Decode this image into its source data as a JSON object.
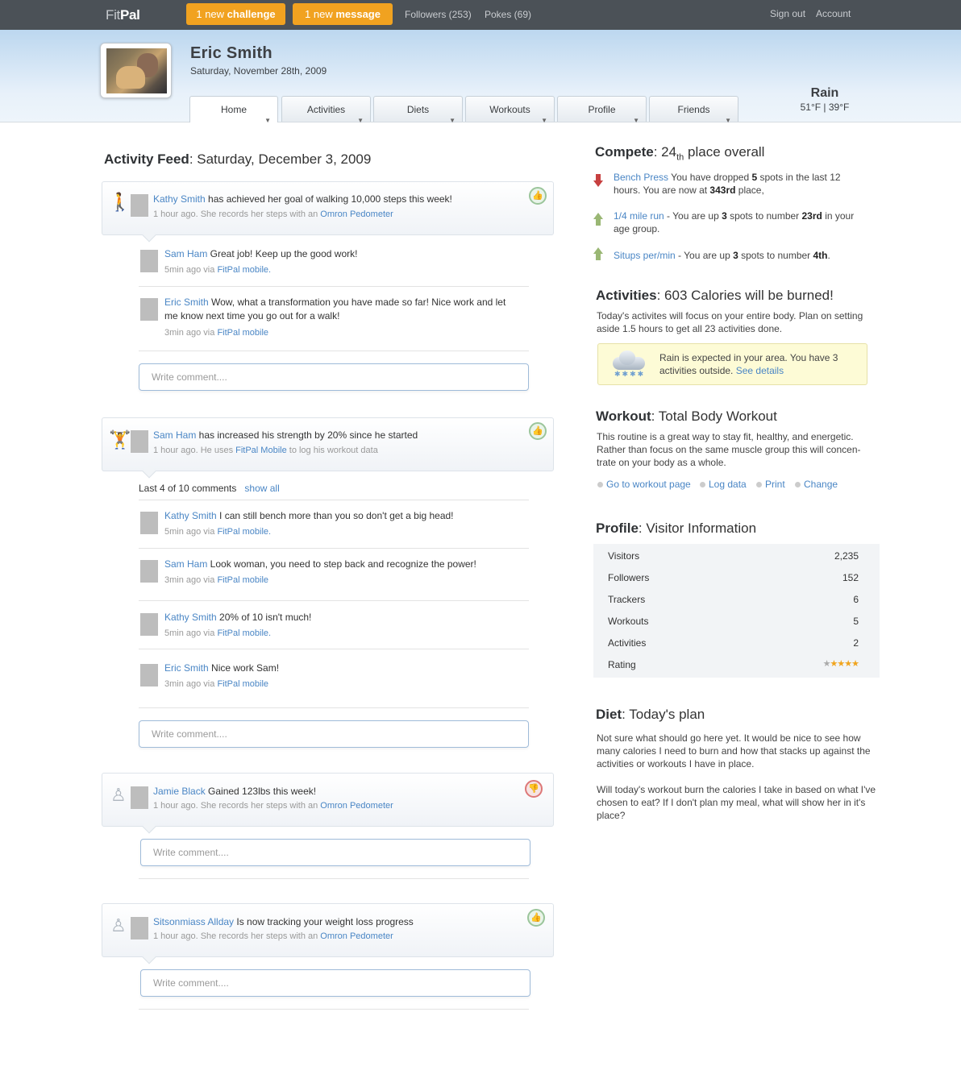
{
  "app": {
    "logo_light": "Fit",
    "logo_bold": "Pal"
  },
  "topbar": {
    "challenge_count": "1 new ",
    "challenge_word": "challenge",
    "message_count": "1 new ",
    "message_word": "message",
    "followers": "Followers (253)",
    "pokes": "Pokes (69)",
    "sign_out": "Sign out",
    "account": "Account"
  },
  "user": {
    "name": "Eric Smith",
    "date": "Saturday, November 28th, 2009"
  },
  "tabs": [
    {
      "label": "Home",
      "active": true
    },
    {
      "label": "Activities"
    },
    {
      "label": "Diets"
    },
    {
      "label": "Workouts"
    },
    {
      "label": "Profile"
    },
    {
      "label": "Friends"
    }
  ],
  "weather": {
    "condition": "Rain",
    "temps": "51°F | 39°F"
  },
  "feed": {
    "title_bold": "Activity Feed",
    "title_rest": ": Saturday, December 3, 2009",
    "posts": [
      {
        "user": "Kathy Smith",
        "text": " has achieved her goal of walking 10,000 steps this week!",
        "meta": "1 hour ago. She records her steps with an ",
        "meta_link": "Omron Pedometer",
        "badge": "up",
        "comments": [
          {
            "user": "Sam Ham",
            "text": "  Great job! Keep up the good work!",
            "meta": "5min ago via ",
            "via": "FitPal mobile."
          },
          {
            "user": "Eric Smith",
            "text": " Wow, what a transformation you have made so far! Nice work and let me know next time you go out for a walk!",
            "meta": "3min ago via ",
            "via": "FitPal mobile"
          }
        ],
        "comment_placeholder": "Write comment...."
      },
      {
        "user": "Sam Ham",
        "text": " has increased his strength by 20% since he started",
        "meta": "1 hour ago. He uses ",
        "meta_link": "FitPal Mobile",
        "meta_after": " to log his workout data",
        "badge": "up",
        "comments_count": "Last 4 of 10 comments",
        "show_all": "show all",
        "comments": [
          {
            "user": "Kathy Smith",
            "text": " I can still bench more than you so don't get a big head!",
            "meta": "5min ago via ",
            "via": "FitPal mobile."
          },
          {
            "user": "Sam Ham",
            "text": "  Look woman, you need to step back and recognize the power!",
            "meta": "3min ago via ",
            "via": "FitPal mobile"
          },
          {
            "user": "Kathy Smith",
            "text": " 20% of 10 isn't much!",
            "meta": "5min ago via ",
            "via": "FitPal mobile."
          },
          {
            "user": "Eric Smith",
            "text": " Nice work Sam!",
            "meta": "3min ago via ",
            "via": "FitPal mobile"
          }
        ],
        "comment_placeholder": "Write comment...."
      },
      {
        "user": "Jamie Black",
        "text": " Gained 123lbs this week!",
        "meta": "1 hour ago. She records her steps with an ",
        "meta_link": "Omron Pedometer",
        "badge": "down",
        "comment_placeholder": "Write comment...."
      },
      {
        "user": "Sitsonmiass Allday",
        "text": "  Is now tracking your weight loss progress",
        "meta": "1 hour ago. She records her steps with an ",
        "meta_link": "Omron Pedometer",
        "badge": "up",
        "comment_placeholder": "Write comment...."
      }
    ]
  },
  "compete": {
    "title_bold": "Compete",
    "title_rest": ": 24",
    "title_sup": "th",
    "title_end": " place overall",
    "items": [
      {
        "direction": "down",
        "link": "Bench Press",
        "t1": " You have dropped ",
        "b1": "5",
        "t2": " spots in the last 12 hours. You are now at ",
        "b2": "343rd",
        "t3": " place,"
      },
      {
        "direction": "up",
        "link": "1/4 mile run",
        "t1": " - You are up ",
        "b1": "3",
        "t2": " spots to number ",
        "b2": "23rd",
        "t3": " in your age group."
      },
      {
        "direction": "up",
        "link": "Situps per/min",
        "t1": " - You are up ",
        "b1": "3",
        "t2": " spots to number ",
        "b2": "4th",
        "t3": "."
      }
    ]
  },
  "activities": {
    "title_bold": "Activities",
    "title_rest": ": 603 Calories will be burned!",
    "desc": "Today's activites will focus on your entire body. Plan on setting aside 1.5 hours to get all 23 activities done.",
    "alert": "Rain is expected in your area. You have 3 activities outside. ",
    "alert_link": "See details"
  },
  "workout": {
    "title_bold": "Workout",
    "title_rest": ": Total Body Workout",
    "desc": "This routine is a great way to stay fit, healthy, and energetic. Rather than focus on the same muscle group this will concen-trate on your body as a whole.",
    "links": [
      "Go to workout page",
      "Log data",
      "Print",
      "Change"
    ]
  },
  "profile": {
    "title_bold": "Profile",
    "title_rest": ": Visitor Information",
    "rows": [
      {
        "label": "Visitors",
        "value": "2,235"
      },
      {
        "label": "Followers",
        "value": "152"
      },
      {
        "label": "Trackers",
        "value": "6"
      },
      {
        "label": "Workouts",
        "value": "5"
      },
      {
        "label": "Activities",
        "value": "2"
      },
      {
        "label": "Rating",
        "value": ""
      }
    ],
    "rating": {
      "stars": 4,
      "max": 5
    }
  },
  "diet": {
    "title_bold": "Diet",
    "title_rest": ": Today's plan",
    "p1": "Not sure what should go here yet. It would be nice to see how many calories I need to burn and how that stacks up against the activities or workouts I have in place.",
    "p2": "Will today's workout burn the calories I take in based on what I've chosen to eat? If I don't plan my meal, what will show her in it's place?"
  },
  "colors": {
    "accent": "#f1a220",
    "topbar": "#4b5157",
    "link": "#4a86c5"
  }
}
